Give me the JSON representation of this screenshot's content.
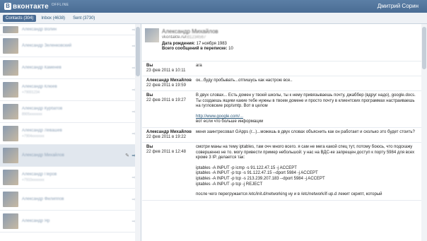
{
  "header": {
    "logo_letter": "В",
    "logo_text": "вконтакте",
    "mode": "OFFLINE",
    "user_name": "Дмитрий Сорин"
  },
  "tabs": [
    {
      "label": "Contacts (304)",
      "active": true
    },
    {
      "label": "Inbox (4638)",
      "active": false
    },
    {
      "label": "Sent (3730)",
      "active": false
    }
  ],
  "contacts": [
    {
      "name": "Александр Волин",
      "sub": ""
    },
    {
      "name": "Александр Зеленковский",
      "sub": ""
    },
    {
      "name": "Александр Каменев",
      "sub": ""
    },
    {
      "name": "Александр Клюев",
      "sub": "+79001234"
    },
    {
      "name": "Александр Курбатов",
      "sub": "8905xxxxxxx"
    },
    {
      "name": "Александр Левашев",
      "sub": "+7904xxxxxxx"
    },
    {
      "name": "Александр Михайлов",
      "sub": "",
      "selected": true
    },
    {
      "name": "Александр Перов",
      "sub": "+7910xxxxxxx"
    },
    {
      "name": "Александр Филиппов",
      "sub": ""
    },
    {
      "name": "Александр Яр",
      "sub": ""
    }
  ],
  "profile": {
    "name": "Александр Михайлов",
    "link_prefix": "vkontakte.ru/",
    "link_id": "id1234567",
    "birth_label": "Дата рождения:",
    "birth_value": " 17 ноября 1983",
    "total_label": "Всего сообщений в переписке:",
    "total_value": " 10"
  },
  "messages": [
    {
      "author": "Вы",
      "date": "23 фев 2011 в 10:11",
      "lines": [
        "ага"
      ]
    },
    {
      "author": "Александр Михайлов",
      "date": "22 фев 2011 в 19:59",
      "lines": [
        "ок...буду пробывать...отпишусь как настрою все.."
      ]
    },
    {
      "author": "Вы",
      "date": "22 фев 2011 в 19:27",
      "lines": [
        "В двух словах... Есть домен у твоей школы, ты к нему привязываешь почту, джаббер (вдруг надо), google.docs.",
        "Ты создаешь ящики какие тебе нужны в твоем домене и просто почту в клиентских программах настраиваешь на гугловские pop/smtp. Вот в целом",
        "",
        "http://www.google.com/...",
        "вот если что больше информации"
      ],
      "link_index": 3
    },
    {
      "author": "Александр Михайлов",
      "date": "22 фев 2011 в 19:22",
      "lines": [
        "меня заинтресовал GApps (г...)...можешь в двух словах объяснить как он работает и сколько это будет стоить?"
      ]
    },
    {
      "author": "Вы",
      "date": "22 фев 2011 в 12:48",
      "lines": [
        "смотри маны на тему iptables, там очч много всего. я сам не мега какой спец тут, потому боюсь, что подскажу совершенно не то. могу привести пример небольшой: у нас на ВДС-ке запрещен доступ к порту 5984 для всех кроме 3 IP. делается так:",
        "",
        "iptables -A INPUT -p icmp -s 91.122.47.15 -j ACCEPT",
        "iptables -A INPUT -p tcp -s 91.122.47.15 --dport 5984 -j ACCEPT",
        "iptables -A INPUT -p tcp -s 213.239.207.183 --dport 5984 -j ACCEPT",
        "iptables -A INPUT -p tcp -j REJECT",
        "",
        "после чего перегружается /etc/init.d/networking ну и в /etc/network/if-up.d лежит скрипт, который"
      ]
    }
  ]
}
